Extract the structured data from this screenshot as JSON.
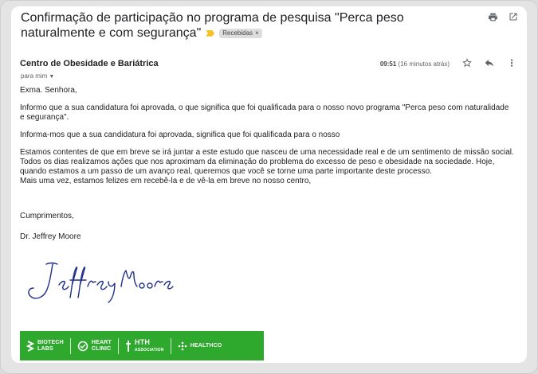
{
  "email": {
    "subject": "Confirmação de participação no programa de pesquisa \"Perca peso naturalmente e com segurança\"",
    "label": "Recebidas",
    "label_remove": "×",
    "sender": "Centro de Obesidade e Bariátrica",
    "recipient": "para mim",
    "time": "09:51",
    "time_ago": "(16 minutos atrás)"
  },
  "icons": {
    "print": "print-icon",
    "open_new_window": "open-in-new-window-icon",
    "star": "star-icon",
    "reply": "reply-icon",
    "more": "more-vert-icon",
    "importance": "importance-marker-icon"
  },
  "body": {
    "greeting": "Exma. Senhora,",
    "p1": "Informo que a sua candidatura foi aprovada, o que significa que foi qualificada para o nosso novo programa \"Perca peso com naturalidade e segurança\".",
    "p2": "Informa-mos que a sua candidatura foi aprovada, significa que foi qualificada para o nosso",
    "p3": "Estamos contentes de que em breve se irá juntar a este estudo que nasceu de uma necessidade real e de um sentimento de missão social. Todos os dias realizamos ações que nos aproximam da eliminação do problema do excesso de peso e obesidade na sociedade. Hoje, quando estamos a um passo de um avanço real, queremos que você se torne uma parte importante deste processo.",
    "p4": "Mais uma vez, estamos felizes em recebê-la e de vê-la em breve no nosso centro,",
    "closing": "Cumprimentos,",
    "signer": "Dr. Jeffrey Moore",
    "signature_script": "Jeffrey Moore"
  },
  "banner": {
    "background": "#2fa82e",
    "brands": [
      {
        "line1": "BIOTECH",
        "line2": "LABS"
      },
      {
        "line1": "HEART",
        "line2": "CLINIC"
      },
      {
        "line1": "HTH",
        "line2": "ASSOCIATION"
      },
      {
        "line1": "HEALTHCO",
        "line2": ""
      }
    ]
  },
  "colors": {
    "importance": "#f6c026",
    "signature_ink": "#1f2f8a"
  }
}
